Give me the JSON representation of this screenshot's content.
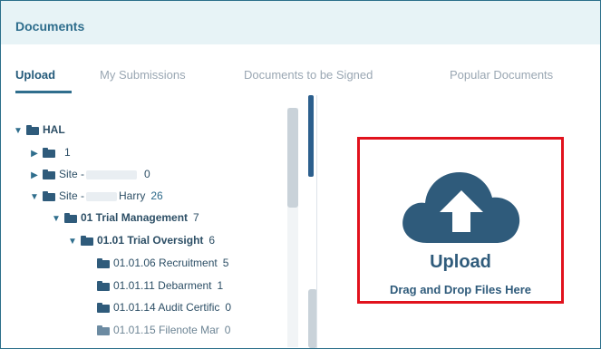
{
  "header": {
    "title": "Documents"
  },
  "tabs": [
    {
      "label": "Upload",
      "active": true
    },
    {
      "label": "My Submissions",
      "active": false
    },
    {
      "label": "Documents to be Signed",
      "active": false
    },
    {
      "label": "Popular Documents",
      "active": false
    }
  ],
  "tree": [
    {
      "label": "HAL",
      "count": "",
      "expander": "▼"
    },
    {
      "label": "",
      "count": "1",
      "expander": "▶"
    },
    {
      "label": "Site -",
      "count": "0",
      "expander": "▶",
      "redacted": true
    },
    {
      "label": "Site -",
      "label2": "Harry",
      "count": "26",
      "expander": "▼",
      "redacted": true
    },
    {
      "label": "01 Trial Management",
      "count": "7",
      "expander": "▼"
    },
    {
      "label": "01.01 Trial Oversight",
      "count": "6",
      "expander": "▼"
    },
    {
      "label": "01.01.06 Recruitment",
      "count": "5",
      "expander": ""
    },
    {
      "label": "01.01.11 Debarment",
      "count": "1",
      "expander": ""
    },
    {
      "label": "01.01.14 Audit Certific",
      "count": "0",
      "expander": ""
    },
    {
      "label": "01.01.15 Filenote Mar",
      "count": "0",
      "expander": ""
    }
  ],
  "upload": {
    "title": "Upload",
    "subtitle": "Drag and Drop Files Here",
    "icon": "cloud-upload-icon"
  },
  "colors": {
    "brand": "#2f5b7b",
    "highlight_border": "#e1121d",
    "header_bg": "#e7f3f6"
  }
}
